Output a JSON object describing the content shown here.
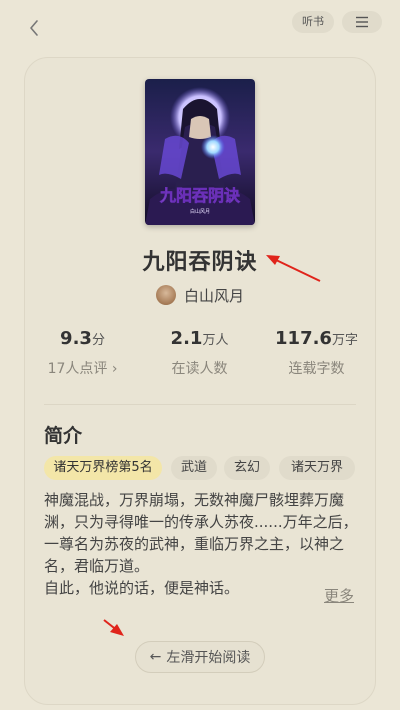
{
  "header": {
    "listen_label": "听书"
  },
  "book": {
    "cover_title": "九阳吞阴诀",
    "cover_author": "白山风月",
    "title": "九阳吞阴诀",
    "author": "白山风月"
  },
  "stats": [
    {
      "value": "9.3",
      "unit": "分",
      "label": "17人点评 ›"
    },
    {
      "value": "2.1",
      "unit": "万人",
      "label": "在读人数"
    },
    {
      "value": "117.6",
      "unit": "万字",
      "label": "连载字数"
    }
  ],
  "intro": {
    "heading": "简介",
    "tags": [
      "诸天万界榜第5名",
      "武道",
      "玄幻",
      "诸天万界"
    ],
    "paragraph1": "神魔混战，万界崩塌，无数神魔尸骸埋葬万魔渊，只为寻得唯一的传承人苏夜......万年之后，一尊名为苏夜的武神，重临万界之主，以神之名，君临万道。",
    "paragraph2": "自此，他说的话，便是神话。",
    "more_label": "更多"
  },
  "footer": {
    "read_label": "左滑开始阅读",
    "read_arrow": "←"
  },
  "colors": {
    "background": "#ebe6d6",
    "rank_tag": "#f3e6a8",
    "annotation_arrow": "#e0241b"
  }
}
